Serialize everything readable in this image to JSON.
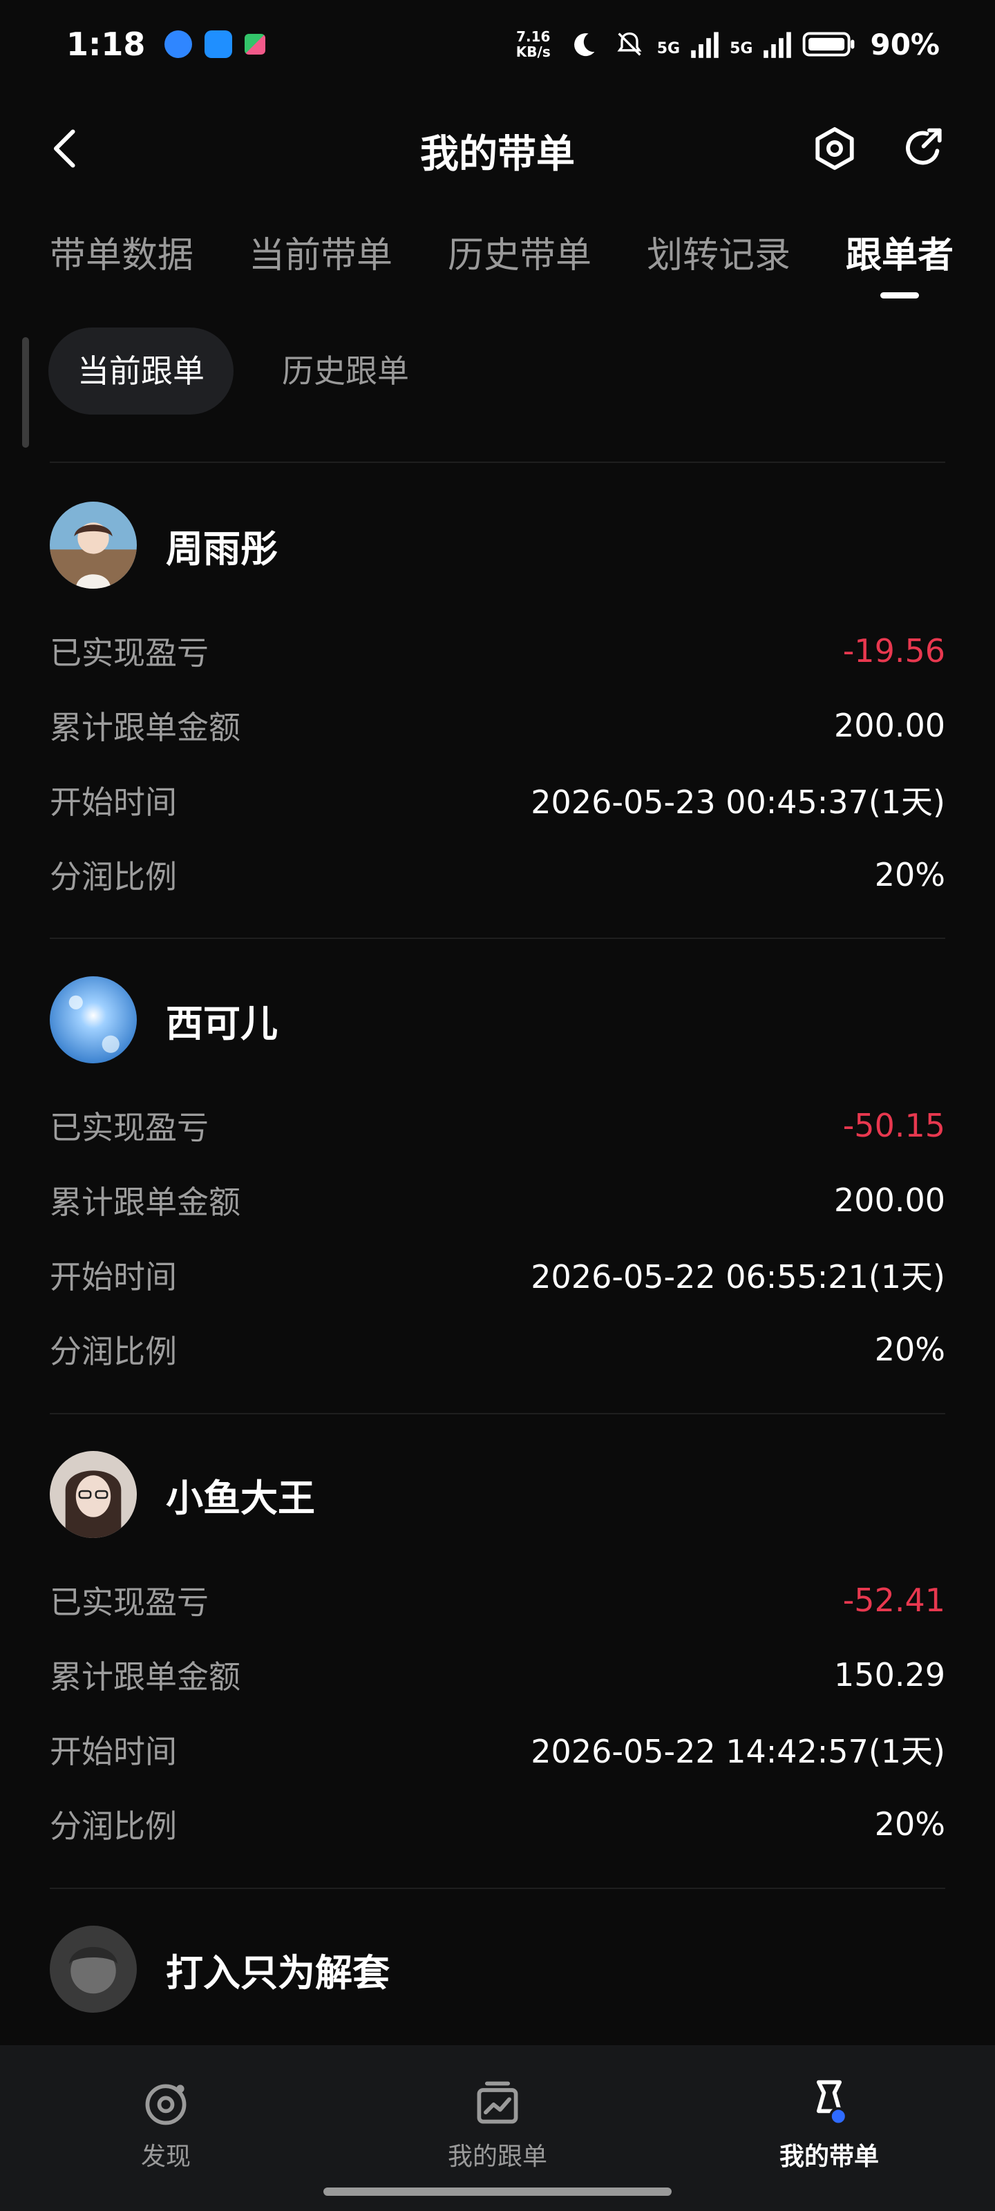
{
  "status_bar": {
    "time": "1:18",
    "net_speed": "7.16",
    "net_unit": "KB/s",
    "signal1_label": "5G",
    "signal2_label": "5G",
    "battery": "90%"
  },
  "header": {
    "title": "我的带单",
    "icons": [
      "back-icon",
      "settings-hexagon-icon",
      "share-icon"
    ]
  },
  "tabs": [
    {
      "label": "带单数据",
      "active": false
    },
    {
      "label": "当前带单",
      "active": false
    },
    {
      "label": "历史带单",
      "active": false
    },
    {
      "label": "划转记录",
      "active": false
    },
    {
      "label": "跟单者",
      "active": true
    }
  ],
  "subtabs": [
    {
      "label": "当前跟单",
      "active": true
    },
    {
      "label": "历史跟单",
      "active": false
    }
  ],
  "labels": {
    "pnl": "已实现盈亏",
    "total": "累计跟单金额",
    "start": "开始时间",
    "share": "分润比例"
  },
  "followers": [
    {
      "name": "周雨彤",
      "pnl": "-19.56",
      "total": "200.00",
      "start": "2026-05-23 00:45:37(1天)",
      "share": "20%"
    },
    {
      "name": "西可儿",
      "pnl": "-50.15",
      "total": "200.00",
      "start": "2026-05-22 06:55:21(1天)",
      "share": "20%"
    },
    {
      "name": "小鱼大王",
      "pnl": "-52.41",
      "total": "150.29",
      "start": "2026-05-22 14:42:57(1天)",
      "share": "20%"
    },
    {
      "name": "打入只为解套"
    }
  ],
  "bottom_nav": [
    {
      "label": "发现",
      "icon": "discover-icon",
      "active": false
    },
    {
      "label": "我的跟单",
      "icon": "follow-chart-icon",
      "active": false
    },
    {
      "label": "我的带单",
      "icon": "lead-trade-icon",
      "active": true
    }
  ],
  "colors": {
    "background": "#0b0b0b",
    "negative": "#e8384f",
    "muted_text": "#9d9d9d",
    "active_nav_accent": "#2f6bff"
  }
}
